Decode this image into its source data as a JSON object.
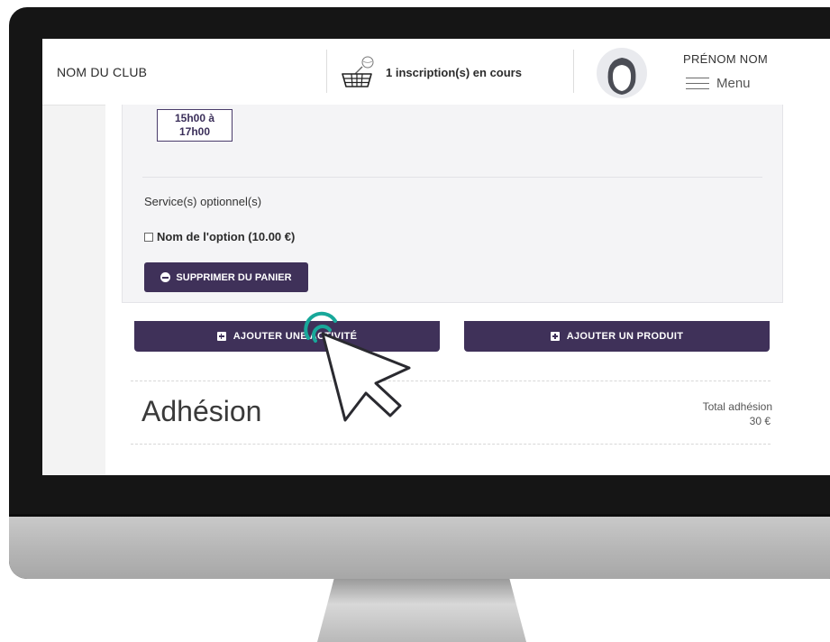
{
  "header": {
    "club_name": "NOM DU CLUB",
    "cart_icon": "basket-with-tennis-ball-icon",
    "cart_text": "1 inscription(s) en cours",
    "user_name": "PRÉNOM NOM",
    "menu_label": "Menu",
    "avatar_icon": "user-avatar-icon"
  },
  "activity": {
    "time_slot_line1": "15h00 à",
    "time_slot_line2": "17h00",
    "services_title": "Service(s) optionnel(s)",
    "option_label": "Nom de l'option (10.00 €)",
    "option_checked": false,
    "remove_button": "SUPPRIMER DU PANIER"
  },
  "actions": {
    "add_activity": "AJOUTER UNE ACTIVITÉ",
    "add_product": "AJOUTER UN PRODUIT"
  },
  "adhesion": {
    "title": "Adhésion",
    "total_label": "Total adhésion",
    "total_value": "30 €"
  },
  "colors": {
    "accent": "#3f3159",
    "click_ripple": "#18a89a"
  }
}
